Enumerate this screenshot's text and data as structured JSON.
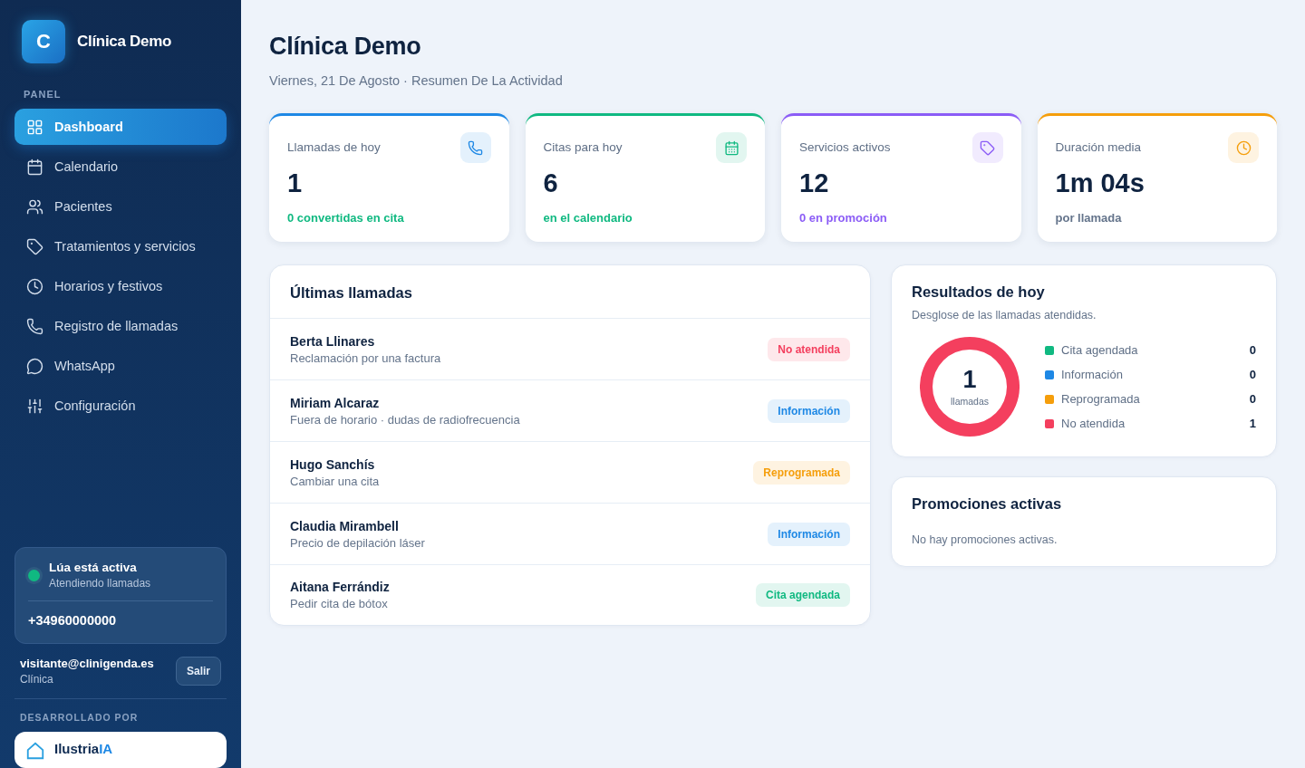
{
  "sidebar": {
    "brand": {
      "letter": "C",
      "name": "Clínica Demo"
    },
    "section": "PANEL",
    "items": [
      {
        "label": "Dashboard",
        "selected": true
      },
      {
        "label": "Calendario",
        "selected": false
      },
      {
        "label": "Pacientes",
        "selected": false
      },
      {
        "label": "Tratamientos y servicios",
        "selected": false
      },
      {
        "label": "Horarios y festivos",
        "selected": false
      },
      {
        "label": "Registro de llamadas",
        "selected": false
      },
      {
        "label": "WhatsApp",
        "selected": false
      },
      {
        "label": "Configuración",
        "selected": false
      }
    ],
    "assistant": {
      "title": "Lúa está activa",
      "subtitle": "Atendiendo llamadas",
      "active": true,
      "phone": "+34960000000"
    },
    "user": {
      "email": "visitante@clinigenda.es",
      "role": "Clínica",
      "logout": "Salir"
    },
    "credit": {
      "label": "DESARROLLADO POR",
      "name": "Ilustria",
      "name_accent": "IA"
    }
  },
  "header": {
    "title": "Clínica Demo",
    "subtitle": "Viernes, 21 De Agosto · Resumen De La Actividad"
  },
  "stats": [
    {
      "label": "Llamadas de hoy",
      "value": "1",
      "note": "0 convertidas en cita",
      "color": "#1e88e5",
      "kind": "positive"
    },
    {
      "label": "Citas para hoy",
      "value": "6",
      "note": "en el calendario",
      "color": "#10b981",
      "kind": "positive"
    },
    {
      "label": "Servicios activos",
      "value": "12",
      "note": "0 en promoción",
      "color": "#8b5cf6",
      "kind": "accent"
    },
    {
      "label": "Duración media",
      "value": "1m 04s",
      "note": "por llamada",
      "color": "#f59e0b",
      "kind": "muted"
    }
  ],
  "recent_calls": {
    "title": "Últimas llamadas",
    "rows": [
      {
        "name": "Berta Llinares",
        "reason": "Reclamación por una factura",
        "status": "No atendida",
        "color": "#f43f5e"
      },
      {
        "name": "Miriam Alcaraz",
        "reason": "Fuera de horario · dudas de radiofrecuencia",
        "status": "Información",
        "color": "#1e88e5"
      },
      {
        "name": "Hugo Sanchís",
        "reason": "Cambiar una cita",
        "status": "Reprogramada",
        "color": "#f59e0b"
      },
      {
        "name": "Claudia Mirambell",
        "reason": "Precio de depilación láser",
        "status": "Información",
        "color": "#1e88e5"
      },
      {
        "name": "Aitana Ferrándiz",
        "reason": "Pedir cita de bótox",
        "status": "Cita agendada",
        "color": "#10b981"
      }
    ]
  },
  "results": {
    "title": "Resultados de hoy",
    "subtitle": "Desglose de las llamadas atendidas.",
    "total": "1",
    "total_label": "llamadas",
    "legend": [
      {
        "label": "Cita agendada",
        "count": "0",
        "color": "#10b981"
      },
      {
        "label": "Información",
        "count": "0",
        "color": "#1e88e5"
      },
      {
        "label": "Reprogramada",
        "count": "0",
        "color": "#f59e0b"
      },
      {
        "label": "No atendida",
        "count": "1",
        "color": "#f43f5e"
      }
    ]
  },
  "promotions": {
    "title": "Promociones activas",
    "empty": "No hay promociones activas."
  }
}
